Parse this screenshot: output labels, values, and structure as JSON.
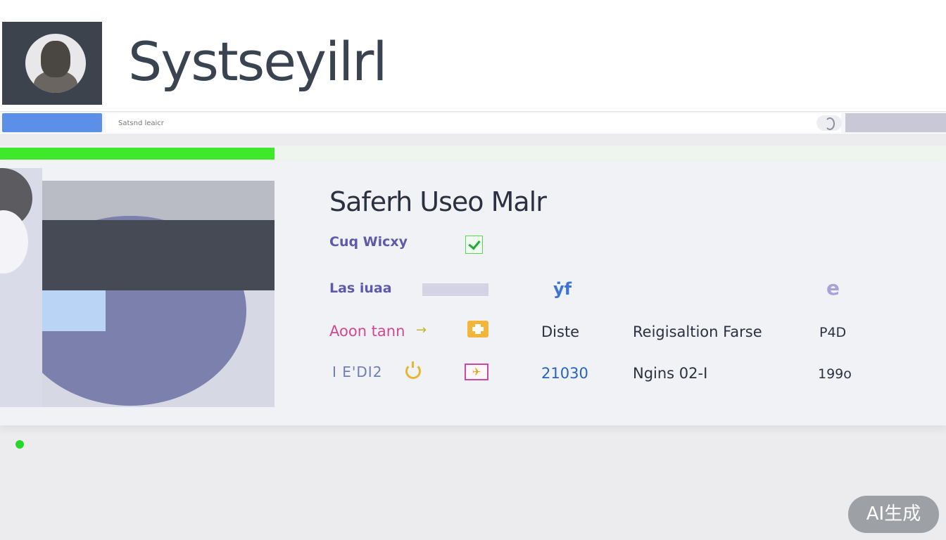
{
  "header": {
    "app_title": "Systseyilrl",
    "avatar_icon": "user-avatar-icon"
  },
  "search": {
    "placeholder": "Satsnd leaicr",
    "button_label": "",
    "icon": "search-icon"
  },
  "progress": {
    "percent": 29,
    "color": "#3ee82a"
  },
  "panel": {
    "title": "Saferh Useo Malr",
    "rows": [
      {
        "label": "Cuq Wicxy",
        "checked": true
      },
      {
        "label": "Las iuaa",
        "icon_a": "ẏf",
        "icon_b": "e"
      },
      {
        "label": "Aoon tann",
        "arrow": "→",
        "col1": "Diste",
        "col2": "Reigisaltion Farse",
        "col3": "P4D"
      },
      {
        "label": "I E'DI2",
        "col1": "21030",
        "col2": "Ngins 02-I",
        "col3": "199o"
      }
    ]
  },
  "badge": {
    "text": "AI生成"
  },
  "colors": {
    "accent_blue": "#5b8fe8",
    "progress_green": "#3ee82a",
    "status_green": "#25d82a",
    "link_blue": "#2566b8",
    "label_purple": "#5e59a8",
    "label_pink": "#d2488e"
  }
}
